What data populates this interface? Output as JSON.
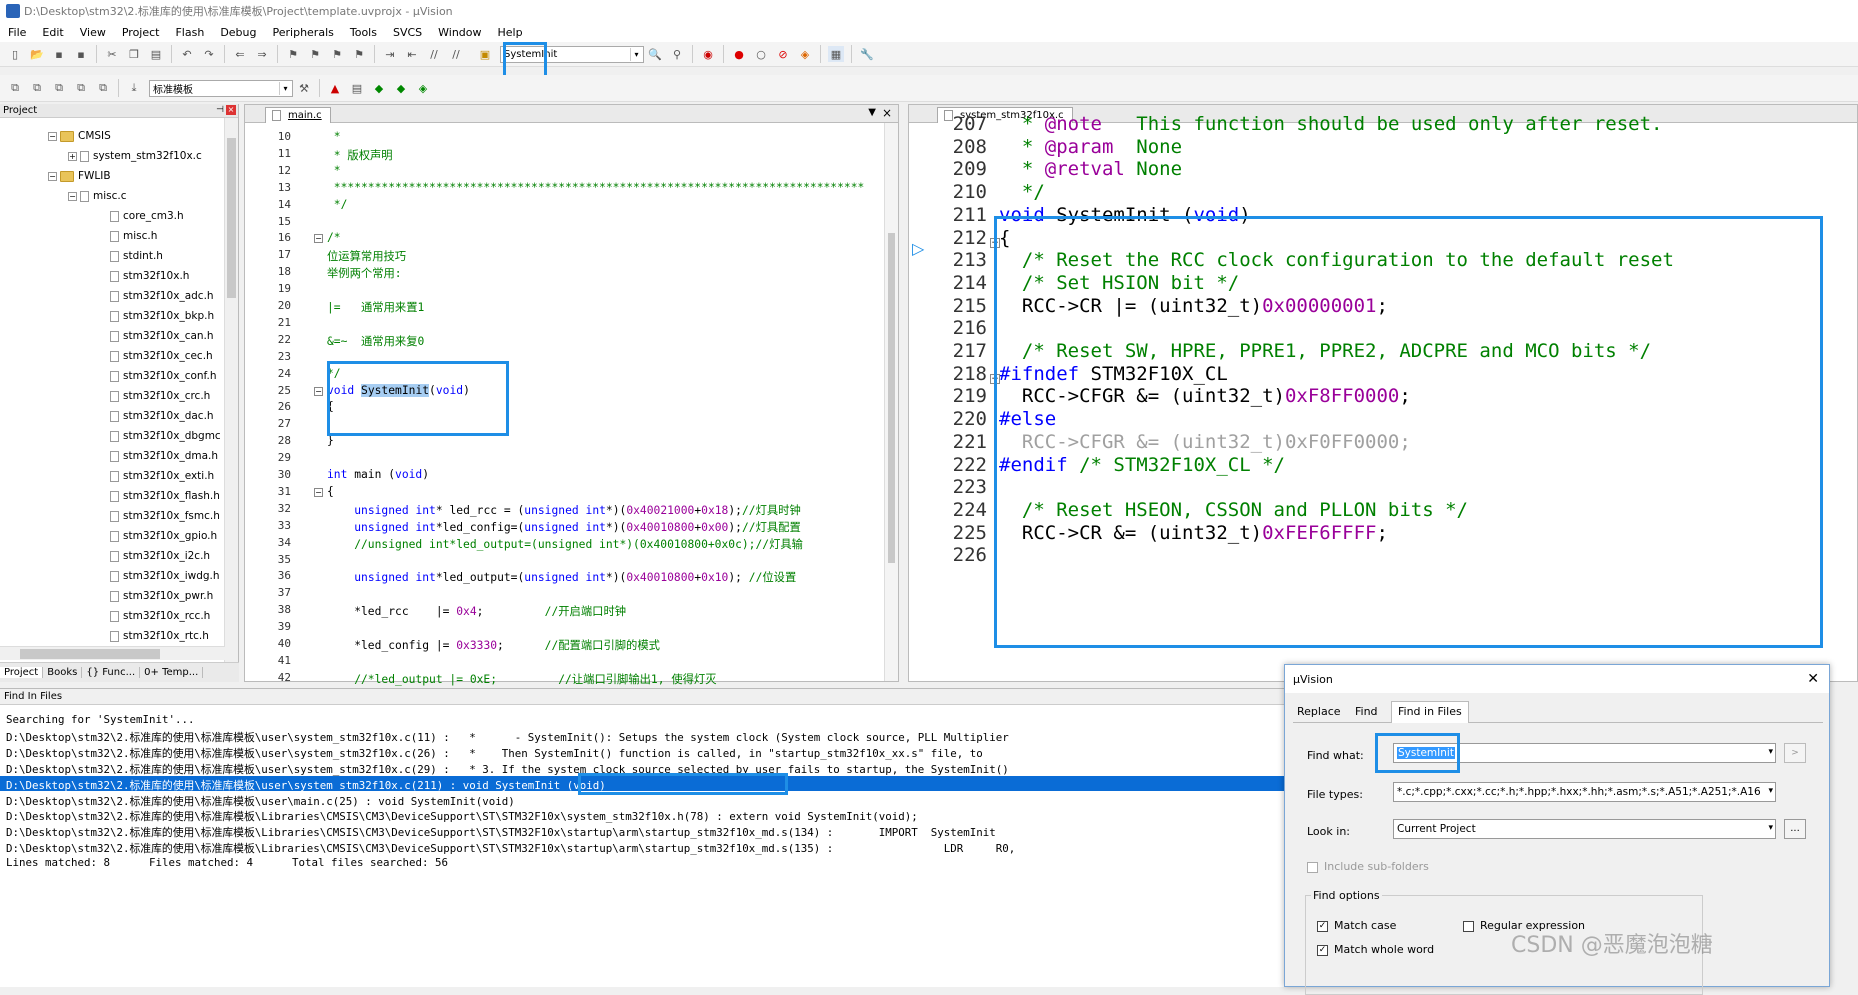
{
  "window": {
    "title": "D:\\Desktop\\stm32\\2.标准库的使用\\标准库模板\\Project\\template.uvprojx - µVision"
  },
  "menu": [
    "File",
    "Edit",
    "View",
    "Project",
    "Flash",
    "Debug",
    "Peripherals",
    "Tools",
    "SVCS",
    "Window",
    "Help"
  ],
  "toolbar": {
    "search_combo": "SystemInit",
    "target_combo": "标准模板"
  },
  "project": {
    "title": "Project",
    "tree": [
      {
        "label": "CMSIS",
        "type": "folder",
        "level": 1
      },
      {
        "label": "system_stm32f10x.c",
        "type": "file",
        "level": 2
      },
      {
        "label": "FWLIB",
        "type": "folder",
        "level": 1
      },
      {
        "label": "misc.c",
        "type": "file",
        "level": 2
      },
      {
        "label": "core_cm3.h",
        "type": "file",
        "level": 3
      },
      {
        "label": "misc.h",
        "type": "file",
        "level": 3
      },
      {
        "label": "stdint.h",
        "type": "file",
        "level": 3
      },
      {
        "label": "stm32f10x.h",
        "type": "file",
        "level": 3
      },
      {
        "label": "stm32f10x_adc.h",
        "type": "file",
        "level": 3
      },
      {
        "label": "stm32f10x_bkp.h",
        "type": "file",
        "level": 3
      },
      {
        "label": "stm32f10x_can.h",
        "type": "file",
        "level": 3
      },
      {
        "label": "stm32f10x_cec.h",
        "type": "file",
        "level": 3
      },
      {
        "label": "stm32f10x_conf.h",
        "type": "file",
        "level": 3
      },
      {
        "label": "stm32f10x_crc.h",
        "type": "file",
        "level": 3
      },
      {
        "label": "stm32f10x_dac.h",
        "type": "file",
        "level": 3
      },
      {
        "label": "stm32f10x_dbgmc",
        "type": "file",
        "level": 3
      },
      {
        "label": "stm32f10x_dma.h",
        "type": "file",
        "level": 3
      },
      {
        "label": "stm32f10x_exti.h",
        "type": "file",
        "level": 3
      },
      {
        "label": "stm32f10x_flash.h",
        "type": "file",
        "level": 3
      },
      {
        "label": "stm32f10x_fsmc.h",
        "type": "file",
        "level": 3
      },
      {
        "label": "stm32f10x_gpio.h",
        "type": "file",
        "level": 3
      },
      {
        "label": "stm32f10x_i2c.h",
        "type": "file",
        "level": 3
      },
      {
        "label": "stm32f10x_iwdg.h",
        "type": "file",
        "level": 3
      },
      {
        "label": "stm32f10x_pwr.h",
        "type": "file",
        "level": 3
      },
      {
        "label": "stm32f10x_rcc.h",
        "type": "file",
        "level": 3
      },
      {
        "label": "stm32f10x_rtc.h",
        "type": "file",
        "level": 3
      }
    ],
    "tabs": [
      "Project",
      "Books",
      "{} Func...",
      "0+ Temp..."
    ]
  },
  "editor_left": {
    "tab": "main.c",
    "lines": [
      {
        "n": "10",
        "t": " *",
        "c": "cmt"
      },
      {
        "n": "11",
        "t": " * 版权声明",
        "c": "cmt"
      },
      {
        "n": "12",
        "t": " *",
        "c": "cmt"
      },
      {
        "n": "13",
        "t": " ******************************************************************************",
        "c": "cmt"
      },
      {
        "n": "14",
        "t": " */",
        "c": "cmt"
      },
      {
        "n": "15",
        "t": "",
        "c": ""
      },
      {
        "n": "16",
        "t": "/*",
        "c": "cmt"
      },
      {
        "n": "17",
        "t": "位运算常用技巧",
        "c": "cmt"
      },
      {
        "n": "18",
        "t": "举例两个常用:",
        "c": "cmt"
      },
      {
        "n": "19",
        "t": "",
        "c": ""
      },
      {
        "n": "20",
        "t": "|=   通常用来置1",
        "c": "cmt"
      },
      {
        "n": "21",
        "t": "",
        "c": ""
      },
      {
        "n": "22",
        "t": "&=~  通常用来复0",
        "c": "cmt"
      },
      {
        "n": "23",
        "t": "",
        "c": ""
      },
      {
        "n": "24",
        "t": "*/",
        "c": "cmt"
      },
      {
        "n": "25",
        "t": "void SystemInit(void)",
        "c": "fn"
      },
      {
        "n": "26",
        "t": "{",
        "c": ""
      },
      {
        "n": "27",
        "t": "",
        "c": ""
      },
      {
        "n": "28",
        "t": "}",
        "c": ""
      },
      {
        "n": "29",
        "t": "",
        "c": ""
      },
      {
        "n": "30",
        "t": "int main (void)",
        "c": "main"
      },
      {
        "n": "31",
        "t": "{",
        "c": ""
      },
      {
        "n": "32",
        "t": "    unsigned int* led_rcc = (unsigned int*)(0x40021000+0x18);//灯具时钟",
        "c": "mix"
      },
      {
        "n": "33",
        "t": "    unsigned int*led_config=(unsigned int*)(0x40010800+0x00);//灯具配置",
        "c": "mix"
      },
      {
        "n": "34",
        "t": "    //unsigned int*led_output=(unsigned int*)(0x40010800+0x0c);//灯具输",
        "c": "cmt"
      },
      {
        "n": "35",
        "t": "",
        "c": ""
      },
      {
        "n": "36",
        "t": "    unsigned int*led_output=(unsigned int*)(0x40010800+0x10); //位设置",
        "c": "mix"
      },
      {
        "n": "37",
        "t": "",
        "c": ""
      },
      {
        "n": "38",
        "t": "    *led_rcc    |= 0x4;         //开启端口时钟",
        "c": "mix"
      },
      {
        "n": "39",
        "t": "",
        "c": ""
      },
      {
        "n": "40",
        "t": "    *led_config |= 0x3330;      //配置端口引脚的模式",
        "c": "mix"
      },
      {
        "n": "41",
        "t": "",
        "c": ""
      },
      {
        "n": "42",
        "t": "    //*led_output |= 0xE;         //让端口引脚输出1, 使得灯灭",
        "c": "cmt"
      }
    ]
  },
  "editor_right": {
    "tab": "system_stm32f10x.c",
    "lines": [
      {
        "n": "207",
        "t": "  * @note   This function should be used only after reset."
      },
      {
        "n": "208",
        "t": "  * @param  None"
      },
      {
        "n": "209",
        "t": "  * @retval None"
      },
      {
        "n": "210",
        "t": "  */"
      },
      {
        "n": "211",
        "t": "void SystemInit (void)"
      },
      {
        "n": "212",
        "t": "{"
      },
      {
        "n": "213",
        "t": "  /* Reset the RCC clock configuration to the default reset"
      },
      {
        "n": "214",
        "t": "  /* Set HSION bit */"
      },
      {
        "n": "215",
        "t": "  RCC->CR |= (uint32_t)0x00000001;"
      },
      {
        "n": "216",
        "t": ""
      },
      {
        "n": "217",
        "t": "  /* Reset SW, HPRE, PPRE1, PPRE2, ADCPRE and MCO bits */"
      },
      {
        "n": "218",
        "t": "#ifndef STM32F10X_CL"
      },
      {
        "n": "219",
        "t": "  RCC->CFGR &= (uint32_t)0xF8FF0000;"
      },
      {
        "n": "220",
        "t": "#else"
      },
      {
        "n": "221",
        "t": "  RCC->CFGR &= (uint32_t)0xF0FF0000;"
      },
      {
        "n": "222",
        "t": "#endif /* STM32F10X_CL */"
      },
      {
        "n": "223",
        "t": ""
      },
      {
        "n": "224",
        "t": "  /* Reset HSEON, CSSON and PLLON bits */"
      },
      {
        "n": "225",
        "t": "  RCC->CR &= (uint32_t)0xFEF6FFFF;"
      },
      {
        "n": "226",
        "t": ""
      }
    ]
  },
  "find_in_files": {
    "title": "Find In Files",
    "lines": [
      "Searching for 'SystemInit'...",
      "D:\\Desktop\\stm32\\2.标准库的使用\\标准库模板\\user\\system_stm32f10x.c(11) :   *      - SystemInit(): Setups the system clock (System clock source, PLL Multiplier",
      "D:\\Desktop\\stm32\\2.标准库的使用\\标准库模板\\user\\system_stm32f10x.c(26) :   *    Then SystemInit() function is called, in \"startup_stm32f10x_xx.s\" file, to",
      "D:\\Desktop\\stm32\\2.标准库的使用\\标准库模板\\user\\system_stm32f10x.c(29) :   * 3. If the system clock source selected by user fails to startup, the SystemInit()",
      "D:\\Desktop\\stm32\\2.标准库的使用\\标准库模板\\user\\system_stm32f10x.c(211) : void SystemInit (void)",
      "D:\\Desktop\\stm32\\2.标准库的使用\\标准库模板\\user\\main.c(25) : void SystemInit(void)",
      "D:\\Desktop\\stm32\\2.标准库的使用\\标准库模板\\Libraries\\CMSIS\\CM3\\DeviceSupport\\ST\\STM32F10x\\system_stm32f10x.h(78) : extern void SystemInit(void);",
      "D:\\Desktop\\stm32\\2.标准库的使用\\标准库模板\\Libraries\\CMSIS\\CM3\\DeviceSupport\\ST\\STM32F10x\\startup\\arm\\startup_stm32f10x_md.s(134) :       IMPORT  SystemInit",
      "D:\\Desktop\\stm32\\2.标准库的使用\\标准库模板\\Libraries\\CMSIS\\CM3\\DeviceSupport\\ST\\STM32F10x\\startup\\arm\\startup_stm32f10x_md.s(135) :                 LDR     R0,",
      "Lines matched: 8      Files matched: 4      Total files searched: 56"
    ],
    "selected_index": 4
  },
  "dialog": {
    "title": "µVision",
    "tabs": [
      "Replace",
      "Find",
      "Find in Files"
    ],
    "find_what_label": "Find what:",
    "find_what_value": "SystemInit",
    "file_types_label": "File types:",
    "file_types_value": "*.c;*.cpp;*.cxx;*.cc;*.h;*.hpp;*.hxx;*.hh;*.asm;*.s;*.A51;*.A251;*.A16",
    "look_in_label": "Look in:",
    "look_in_value": "Current Project",
    "include_subfolders": "Include sub-folders",
    "find_options": "Find options",
    "match_case": "Match case",
    "regex": "Regular expression",
    "whole_word": "Match whole word",
    "browse": "..."
  },
  "watermark": "CSDN @恶魔泡泡糖"
}
